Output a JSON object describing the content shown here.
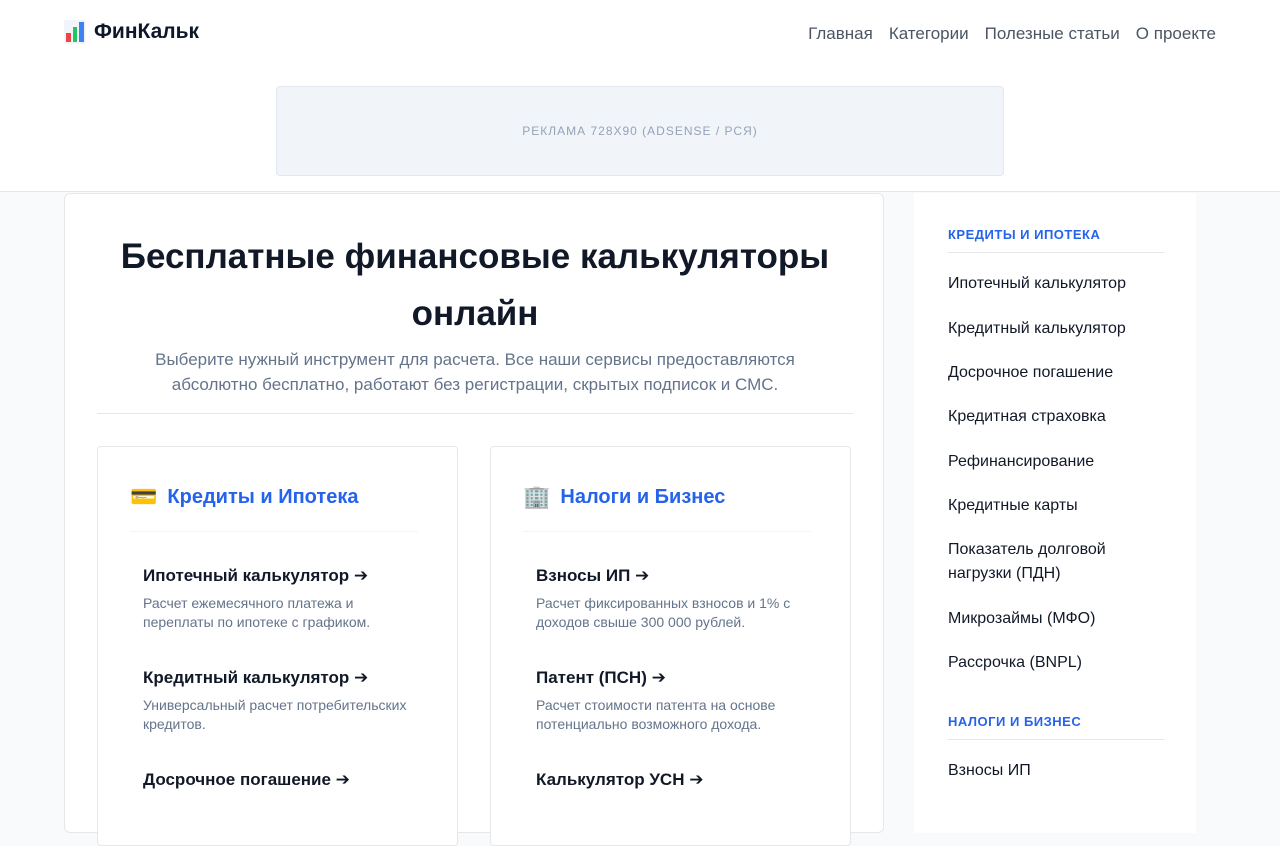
{
  "header": {
    "logo_text": "ФинКальк",
    "logo_icon": "bar-chart-icon",
    "nav": [
      "Главная",
      "Категории",
      "Полезные статьи",
      "О проекте"
    ]
  },
  "ad": {
    "text": "РЕКЛАМА 728X90 (ADSENSE / РСЯ)"
  },
  "hero": {
    "title": "Бесплатные финансовые калькуляторы онлайн",
    "subtitle": "Выберите нужный инструмент для расчета. Все наши сервисы предоставляются абсолютно бесплатно, работают без регистрации, скрытых подписок и СМС."
  },
  "cards": [
    {
      "icon": "credit-card-icon",
      "title": "Кредиты и Ипотека",
      "items": [
        {
          "title": "Ипотечный калькулятор ➔",
          "desc": "Расчет ежемесячного платежа и переплаты по ипотеке с графиком."
        },
        {
          "title": "Кредитный калькулятор ➔",
          "desc": "Универсальный расчет потребительских кредитов."
        },
        {
          "title": "Досрочное погашение ➔",
          "desc": ""
        }
      ]
    },
    {
      "icon": "office-building-icon",
      "title": "Налоги и Бизнес",
      "items": [
        {
          "title": "Взносы ИП ➔",
          "desc": "Расчет фиксированных взносов и 1% с доходов свыше 300 000 рублей."
        },
        {
          "title": "Патент (ПСН) ➔",
          "desc": "Расчет стоимости патента на основе потенциально возможного дохода."
        },
        {
          "title": "Калькулятор УСН ➔",
          "desc": ""
        }
      ]
    }
  ],
  "sidebar": {
    "sections": [
      {
        "heading": "КРЕДИТЫ И ИПОТЕКА",
        "links": [
          "Ипотечный калькулятор",
          "Кредитный калькулятор",
          "Досрочное погашение",
          "Кредитная страховка",
          "Рефинансирование",
          "Кредитные карты",
          "Показатель долговой нагрузки (ПДН)",
          "Микрозаймы (МФО)",
          "Рассрочка (BNPL)"
        ]
      },
      {
        "heading": "НАЛОГИ И БИЗНЕС",
        "links": [
          "Взносы ИП"
        ]
      }
    ]
  },
  "colors": {
    "accent": "#2563eb",
    "text": "#111827",
    "muted": "#64748b"
  }
}
